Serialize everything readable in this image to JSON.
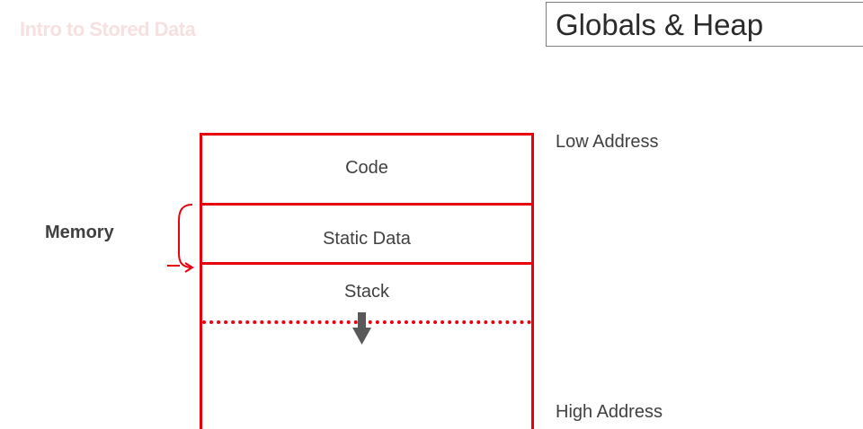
{
  "header": {
    "faint_text": "Intro to Stored Data",
    "title": "Globals & Heap"
  },
  "diagram": {
    "left_label": "Memory",
    "low_address": "Low Address",
    "high_address": "High Address",
    "segments": [
      "Code",
      "Static Data",
      "Stack"
    ]
  },
  "colors": {
    "segment_border": "#e8000d",
    "annotation": "#e8000d",
    "arrow": "#595959",
    "text": "#404040"
  }
}
